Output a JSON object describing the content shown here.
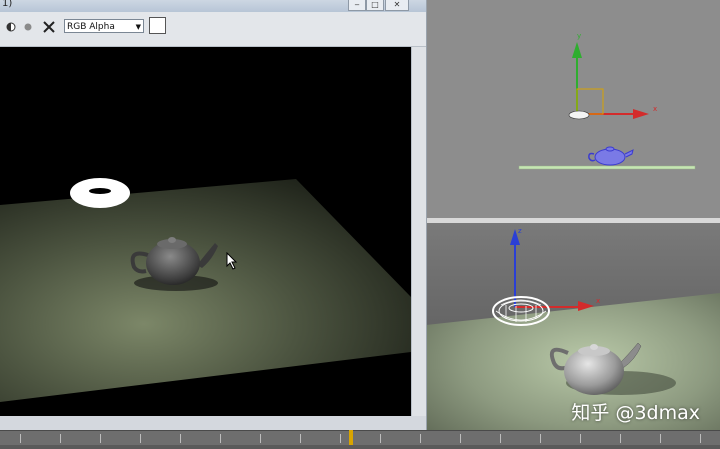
{
  "render_window": {
    "title": "1)",
    "channel_select": {
      "value": "RGB Alpha"
    },
    "window_controls": {
      "minimize": "‒",
      "maximize": "□",
      "close": "✕"
    }
  },
  "toolbar_icons": [
    "half-circle-icon",
    "dot-icon",
    "clear-icon"
  ],
  "colors": {
    "viewport_top_bg": "#8d8d8d",
    "axis_x": "#d32b2b",
    "axis_y": "#2fae2f",
    "axis_z": "#2a3fd6",
    "teapot_wire": "#5a5ae8",
    "ground_line": "#c6e6b3"
  },
  "viewport_top": {
    "axis_x_label": "x",
    "axis_y_label": "y"
  },
  "viewport_persp": {
    "axis_x_label": "x",
    "axis_z_label": "z"
  },
  "watermark": "知乎 @3dmax"
}
